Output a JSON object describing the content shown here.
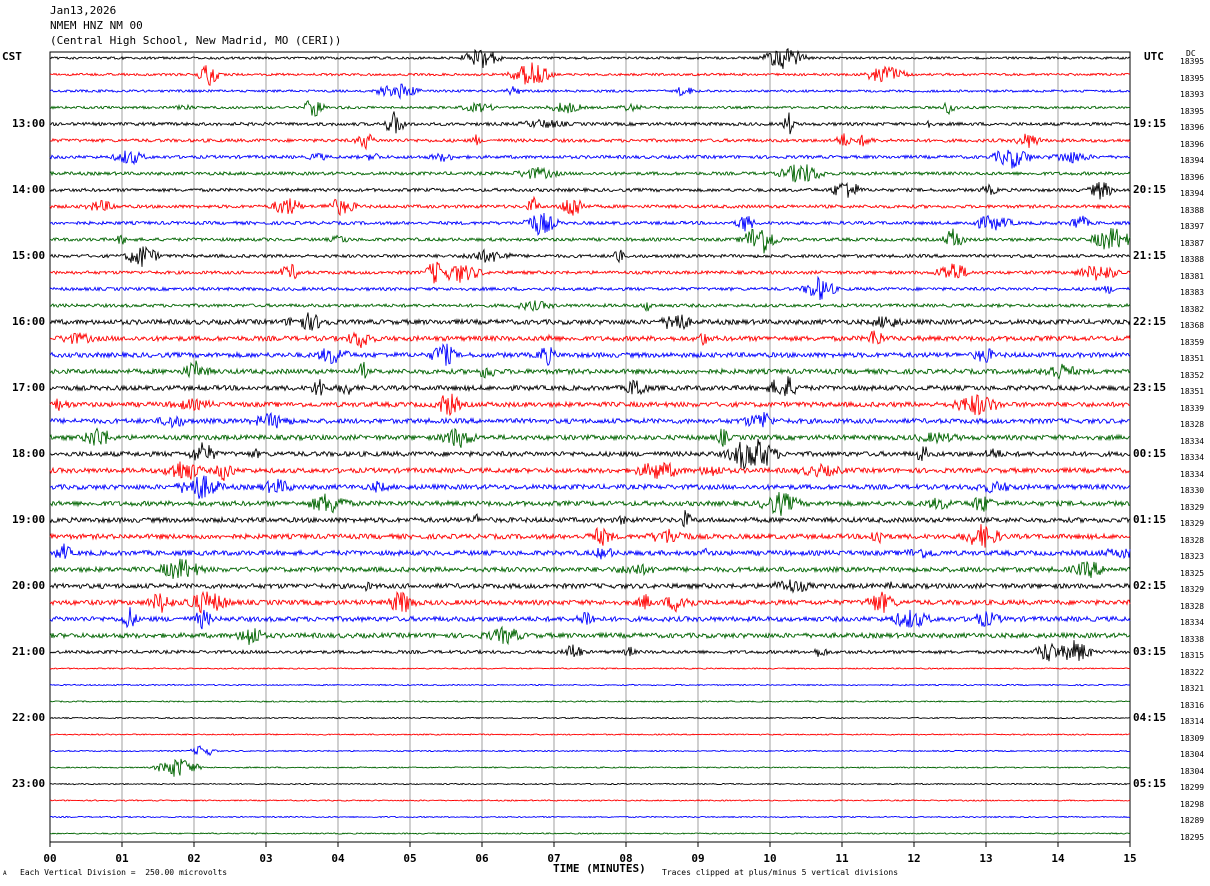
{
  "header": {
    "date": "Jan13,2026",
    "station": "NMEM HNZ NM 00",
    "location": "(Central High School, New Madrid, MO (CERI))"
  },
  "left_tz": "CST",
  "right_tz": "UTC",
  "dc_label": "DC",
  "footer": {
    "scale_note": "Each Vertical Division =  250.00 microvolts",
    "clip_note": "Traces clipped at plus/minus 5 vertical divisions",
    "corner_mark": "A"
  },
  "chart_data": {
    "type": "line",
    "title": "NMEM HNZ NM 00",
    "xlabel": "TIME (MINUTES)",
    "xlim": [
      0,
      15
    ],
    "x_ticks": [
      "00",
      "01",
      "02",
      "03",
      "04",
      "05",
      "06",
      "07",
      "08",
      "09",
      "10",
      "11",
      "12",
      "13",
      "14",
      "15"
    ],
    "line_colors": [
      "#000000",
      "#ff0000",
      "#0000ff",
      "#006400"
    ],
    "left_hour_labels": [
      "13:00",
      "14:00",
      "15:00",
      "16:00",
      "17:00",
      "18:00",
      "19:00",
      "20:00",
      "21:00",
      "22:00",
      "23:00"
    ],
    "right_hour_labels": [
      "19:15",
      "20:15",
      "21:15",
      "22:15",
      "23:15",
      "00:15",
      "01:15",
      "02:15",
      "03:15",
      "04:15",
      "05:15"
    ],
    "trace_dc_offsets": [
      18395,
      18395,
      18393,
      18395,
      18396,
      18396,
      18394,
      18396,
      18394,
      18388,
      18397,
      18387,
      18388,
      18381,
      18383,
      18382,
      18368,
      18359,
      18351,
      18352,
      18351,
      18339,
      18328,
      18334,
      18334,
      18334,
      18330,
      18329,
      18329,
      18328,
      18323,
      18325,
      18329,
      18328,
      18334,
      18338,
      18315,
      18322,
      18321,
      18316,
      18314,
      18309,
      18304,
      18304,
      18299,
      18298,
      18289,
      18295
    ],
    "grid": true
  }
}
